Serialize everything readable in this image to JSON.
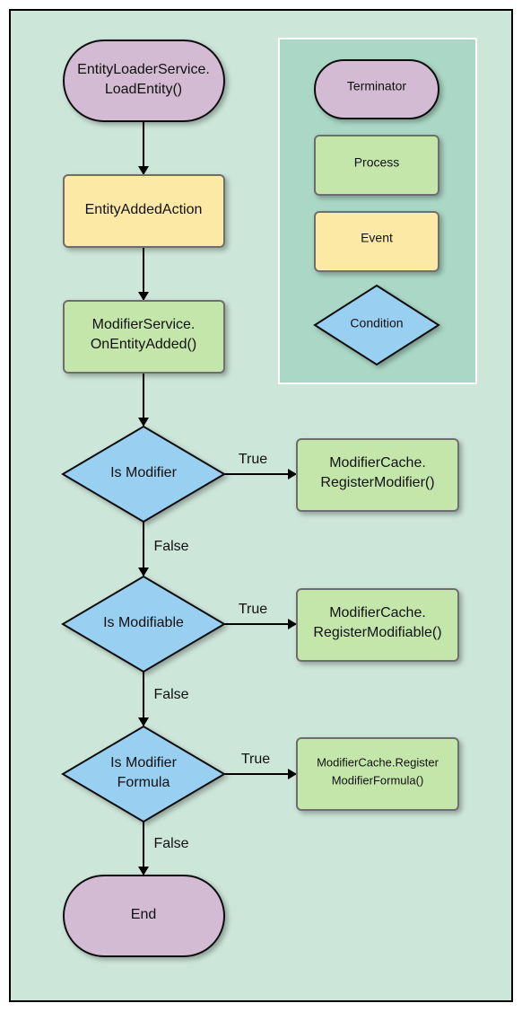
{
  "colors": {
    "background": "#cde6da",
    "legend_background": "#abd8c6",
    "terminator": "#d3bbd3",
    "process": "#c5e6ab",
    "event": "#fde9a6",
    "condition": "#99d0f1"
  },
  "legend": {
    "terminator": "Terminator",
    "process": "Process",
    "event": "Event",
    "condition": "Condition"
  },
  "nodes": {
    "start": {
      "line1": "EntityLoaderService.",
      "line2": "LoadEntity()"
    },
    "event": {
      "line1": "EntityAddedAction"
    },
    "on_added": {
      "line1": "ModifierService.",
      "line2": "OnEntityAdded()"
    },
    "cond1": {
      "line1": "Is Modifier"
    },
    "cond2": {
      "line1": "Is Modifiable"
    },
    "cond3": {
      "line1": "Is Modifier",
      "line2": "Formula"
    },
    "reg_modifier": {
      "line1": "ModifierCache.",
      "line2": "RegisterModifier()"
    },
    "reg_modifiable": {
      "line1": "ModifierCache.",
      "line2": "RegisterModifiable()"
    },
    "reg_formula": {
      "line1": "ModifierCache.Register",
      "line2": "ModifierFormula()"
    },
    "end": {
      "line1": "End"
    }
  },
  "edges": {
    "true_label": "True",
    "false_label": "False"
  }
}
